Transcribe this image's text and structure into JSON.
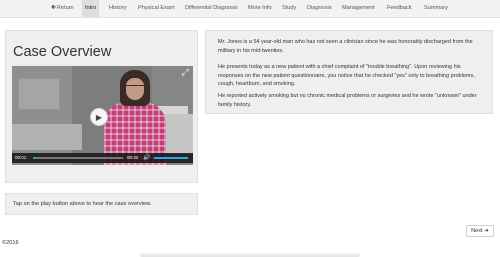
{
  "nav": {
    "return_label": "Return",
    "return_icon": "left-arrow-icon",
    "tabs": [
      {
        "label": "Intro",
        "active": true
      },
      {
        "label": "History"
      },
      {
        "label": "Physical Exam"
      },
      {
        "label": "Differential Diagnosis"
      },
      {
        "label": "More Info"
      },
      {
        "label": "Study"
      },
      {
        "label": "Diagnosis"
      },
      {
        "label": "Management"
      },
      {
        "label": "Feedback"
      },
      {
        "label": "Summary"
      }
    ]
  },
  "case": {
    "title": "Case Overview"
  },
  "video": {
    "current_time": "00:01",
    "total_time": "00:32",
    "progress": 0.02,
    "play_icon": "play-icon",
    "fullscreen_icon": "fullscreen-icon",
    "volume_icon": "volume-icon",
    "accent_color": "#2aa7e0"
  },
  "description": {
    "paragraphs": [
      "Mr. Jones is a 54 year-old man who has not seen a clinician since he was honorably discharged from the military in his mid-twenties.",
      "He presents today as a new patient with a chief complaint of \"trouble breathing\". Upon reviewing his responses on the new patient questionnaire, you notice that he checked \"yes\" only to breathing problems, cough, heartburn, and smoking.",
      "He reported actively smoking but no chronic medical problems or surgeries and he wrote \"unknown\" under family history."
    ]
  },
  "instruction": "Tap on the play button above to hear the case overview.",
  "next_label": "Next",
  "next_icon": "right-arrow-icon",
  "footer": {
    "copyright": "©2016"
  }
}
